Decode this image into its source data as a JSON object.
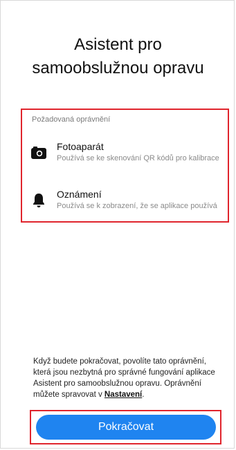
{
  "title": "Asistent pro samoobslužnou opravu",
  "permissions": {
    "header": "Požadovaná oprávnění",
    "items": [
      {
        "name": "Fotoaparát",
        "description": "Používá se ke skenování QR kódů pro kalibrace",
        "icon": "camera-icon"
      },
      {
        "name": "Oznámení",
        "description": "Používá se k zobrazení, že se aplikace používá",
        "icon": "bell-icon"
      }
    ]
  },
  "footer": {
    "text_before_link": "Když budete pokračovat, povolíte tato oprávnění, která jsou nezbytná pro správné fungování aplikace Asistent pro samoobslužnou opravu. Oprávnění můžete spravovat v ",
    "link_label": "Nastavení",
    "text_after_link": "."
  },
  "continue_label": "Pokračovat",
  "colors": {
    "accent": "#1f84f0",
    "highlight": "#e0242c"
  }
}
